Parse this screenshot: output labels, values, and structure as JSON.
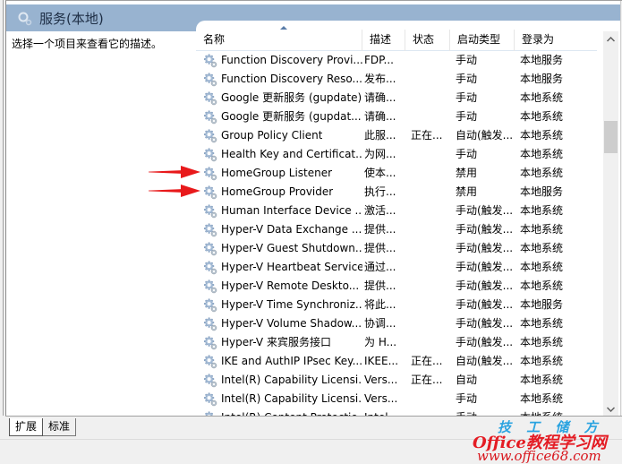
{
  "window": {
    "header_title": "服务(本地)",
    "description_prompt": "选择一个项目来查看它的描述。"
  },
  "columns": [
    "名称",
    "描述",
    "状态",
    "启动类型",
    "登录为"
  ],
  "sort": {
    "column": "名称",
    "direction": "ascending"
  },
  "services": [
    {
      "name": "Function Discovery Provi...",
      "desc": "FDP...",
      "status": "",
      "startup": "手动",
      "logon": "本地服务"
    },
    {
      "name": "Function Discovery Reso...",
      "desc": "发布...",
      "status": "",
      "startup": "手动",
      "logon": "本地服务"
    },
    {
      "name": "Google 更新服务 (gupdate)",
      "desc": "请确...",
      "status": "",
      "startup": "手动",
      "logon": "本地系统"
    },
    {
      "name": "Google 更新服务 (gupdat...",
      "desc": "请确...",
      "status": "",
      "startup": "手动",
      "logon": "本地系统"
    },
    {
      "name": "Group Policy Client",
      "desc": "此服...",
      "status": "正在...",
      "startup": "自动(触发...",
      "logon": "本地系统"
    },
    {
      "name": "Health Key and Certificat...",
      "desc": "为网...",
      "status": "",
      "startup": "手动",
      "logon": "本地系统"
    },
    {
      "name": "HomeGroup Listener",
      "desc": "使本...",
      "status": "",
      "startup": "禁用",
      "logon": "本地系统"
    },
    {
      "name": "HomeGroup Provider",
      "desc": "执行...",
      "status": "",
      "startup": "禁用",
      "logon": "本地服务"
    },
    {
      "name": "Human Interface Device ...",
      "desc": "激活...",
      "status": "",
      "startup": "手动(触发...",
      "logon": "本地系统"
    },
    {
      "name": "Hyper-V Data Exchange ...",
      "desc": "提供...",
      "status": "",
      "startup": "手动(触发...",
      "logon": "本地系统"
    },
    {
      "name": "Hyper-V Guest Shutdown...",
      "desc": "提供...",
      "status": "",
      "startup": "手动(触发...",
      "logon": "本地系统"
    },
    {
      "name": "Hyper-V Heartbeat Service",
      "desc": "通过...",
      "status": "",
      "startup": "手动(触发...",
      "logon": "本地系统"
    },
    {
      "name": "Hyper-V Remote Deskto...",
      "desc": "提供...",
      "status": "",
      "startup": "手动(触发...",
      "logon": "本地系统"
    },
    {
      "name": "Hyper-V Time Synchroniz...",
      "desc": "将此...",
      "status": "",
      "startup": "手动(触发...",
      "logon": "本地服务"
    },
    {
      "name": "Hyper-V Volume Shadow...",
      "desc": "协调...",
      "status": "",
      "startup": "手动(触发...",
      "logon": "本地系统"
    },
    {
      "name": "Hyper-V 来宾服务接口",
      "desc": "为 H...",
      "status": "",
      "startup": "手动(触发...",
      "logon": "本地系统"
    },
    {
      "name": "IKE and AuthIP IPsec Key...",
      "desc": "IKEE...",
      "status": "正在...",
      "startup": "自动(触发...",
      "logon": "本地系统"
    },
    {
      "name": "Intel(R) Capability Licensi...",
      "desc": "Vers...",
      "status": "正在...",
      "startup": "自动",
      "logon": "本地系统"
    },
    {
      "name": "Intel(R) Capability Licensi...",
      "desc": "Vers...",
      "status": "",
      "startup": "手动",
      "logon": "本地系统"
    },
    {
      "name": "Intel(R) Content Protectio...",
      "desc": "Intel...",
      "status": "",
      "startup": "手动",
      "logon": "本地系统"
    }
  ],
  "highlighted_rows": [
    "HomeGroup Listener",
    "HomeGroup Provider"
  ],
  "scrollbar": {
    "position_fraction": 0.25
  },
  "tabs": [
    {
      "label": "扩展",
      "active": true
    },
    {
      "label": "标准",
      "active": false
    }
  ],
  "watermark": {
    "line1": "技 工 储 方",
    "line2": "Office教程学习网",
    "line3": "www.office68.com"
  },
  "colors": {
    "header_band": "#98b3d0",
    "arrow": "#e8191b",
    "watermark_red": "#e41c24",
    "watermark_blue": "#2aa3e0"
  }
}
